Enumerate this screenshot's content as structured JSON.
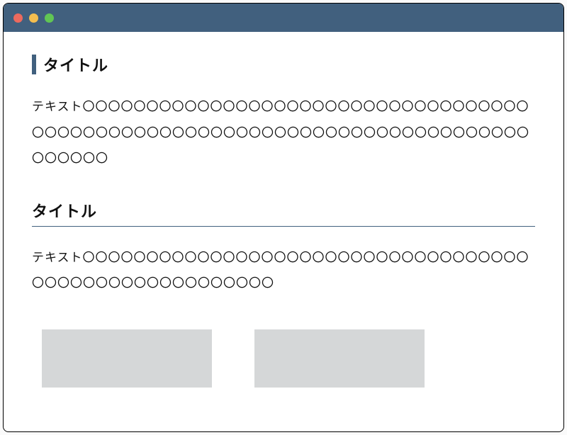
{
  "colors": {
    "titlebar": "#41607e",
    "accent": "#41607e",
    "boxFill": "#d5d7d8",
    "dotRed": "#ec6a5e",
    "dotYellow": "#f4be4f",
    "dotGreen": "#61c654"
  },
  "section1": {
    "title": "タイトル",
    "body": "テキスト〇〇〇〇〇〇〇〇〇〇〇〇〇〇〇〇〇〇〇〇〇〇〇〇〇〇〇〇〇〇〇〇〇〇〇〇〇〇〇〇〇〇〇〇〇〇〇〇〇〇〇〇〇〇〇〇〇〇〇〇〇〇〇〇〇〇〇〇〇〇〇〇〇〇〇〇〇〇〇〇"
  },
  "section2": {
    "title": "タイトル",
    "body": "テキスト〇〇〇〇〇〇〇〇〇〇〇〇〇〇〇〇〇〇〇〇〇〇〇〇〇〇〇〇〇〇〇〇〇〇〇〇〇〇〇〇〇〇〇〇〇〇〇〇〇〇〇〇〇〇"
  }
}
